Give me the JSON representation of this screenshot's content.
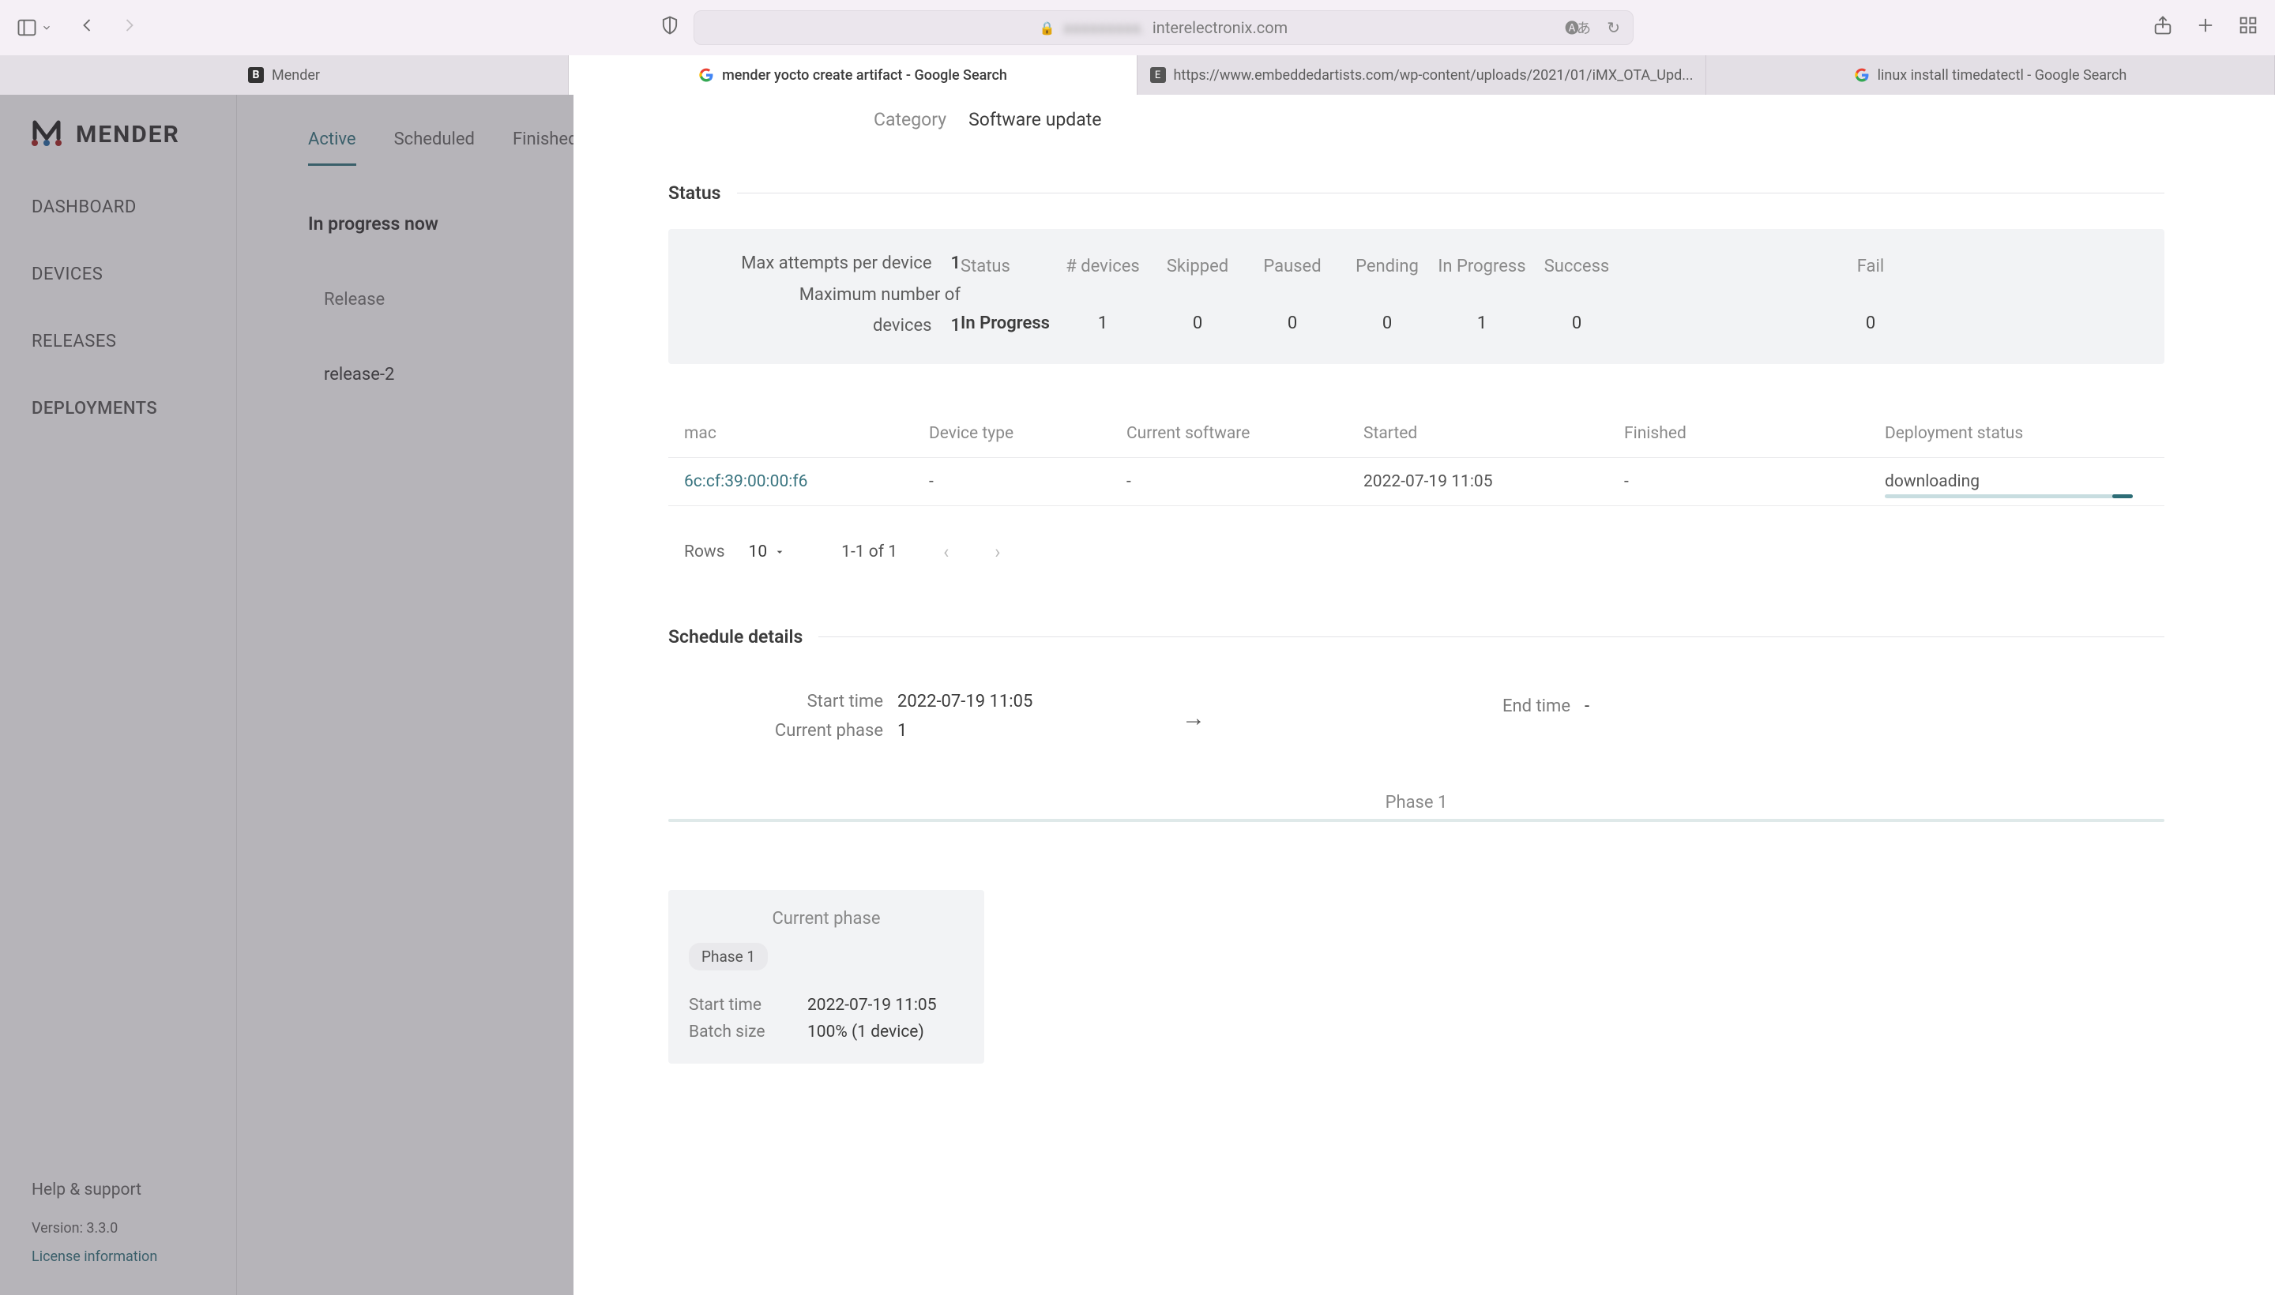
{
  "browser": {
    "url_visible": "interelectronix.com",
    "tabs": [
      {
        "label": "Mender",
        "icon": "b"
      },
      {
        "label": "mender yocto create artifact - Google Search",
        "icon": "g"
      },
      {
        "label": "https://www.embeddedartists.com/wp-content/uploads/2021/01/iMX_OTA_Upd...",
        "icon": "e"
      },
      {
        "label": "linux install timedatectl - Google Search",
        "icon": "g"
      }
    ],
    "active_tab_index": 1
  },
  "sidebar": {
    "brand": "MENDER",
    "items": [
      {
        "label": "DASHBOARD"
      },
      {
        "label": "DEVICES"
      },
      {
        "label": "RELEASES"
      },
      {
        "label": "DEPLOYMENTS"
      }
    ],
    "selected_index": 3,
    "help": "Help & support",
    "version": "Version: 3.3.0",
    "license": "License information"
  },
  "deployments": {
    "tabs": [
      {
        "label": "Active"
      },
      {
        "label": "Scheduled"
      },
      {
        "label": "Finished"
      }
    ],
    "selected_tab": 0,
    "subheading": "In progress now",
    "release_label": "Release",
    "release_value": "release-2"
  },
  "detail": {
    "category_label": "Category",
    "category_value": "Software update",
    "status_title": "Status",
    "status": {
      "status_label": "Status",
      "status_value": "In Progress",
      "cols": [
        "# devices",
        "Skipped",
        "Paused",
        "Pending",
        "In Progress",
        "Success",
        "Fail"
      ],
      "vals": [
        "1",
        "0",
        "0",
        "0",
        "1",
        "0",
        "0"
      ],
      "right": [
        {
          "label": "Max attempts per device",
          "value": "1"
        },
        {
          "label": "Maximum number of devices",
          "value": "1"
        }
      ]
    },
    "table": {
      "headers": [
        "mac",
        "Device type",
        "Current software",
        "Started",
        "Finished",
        "Deployment status"
      ],
      "rows": [
        {
          "mac": "6c:cf:39:00:00:f6",
          "device_type": "-",
          "current_software": "-",
          "started": "2022-07-19 11:05",
          "finished": "-",
          "status": "downloading"
        }
      ]
    },
    "pager": {
      "rows_label": "Rows",
      "rows_value": "10",
      "range": "1-1 of 1"
    },
    "schedule_title": "Schedule details",
    "schedule": {
      "start_label": "Start time",
      "start_value": "2022-07-19 11:05",
      "phase_label": "Current phase",
      "phase_value": "1",
      "end_label": "End time",
      "end_value": "-"
    },
    "phasebar_label": "Phase 1",
    "phase_card": {
      "title": "Current phase",
      "chip": "Phase 1",
      "start_label": "Start time",
      "start_value": "2022-07-19 11:05",
      "batch_label": "Batch size",
      "batch_value": "100% (1 device)"
    }
  }
}
